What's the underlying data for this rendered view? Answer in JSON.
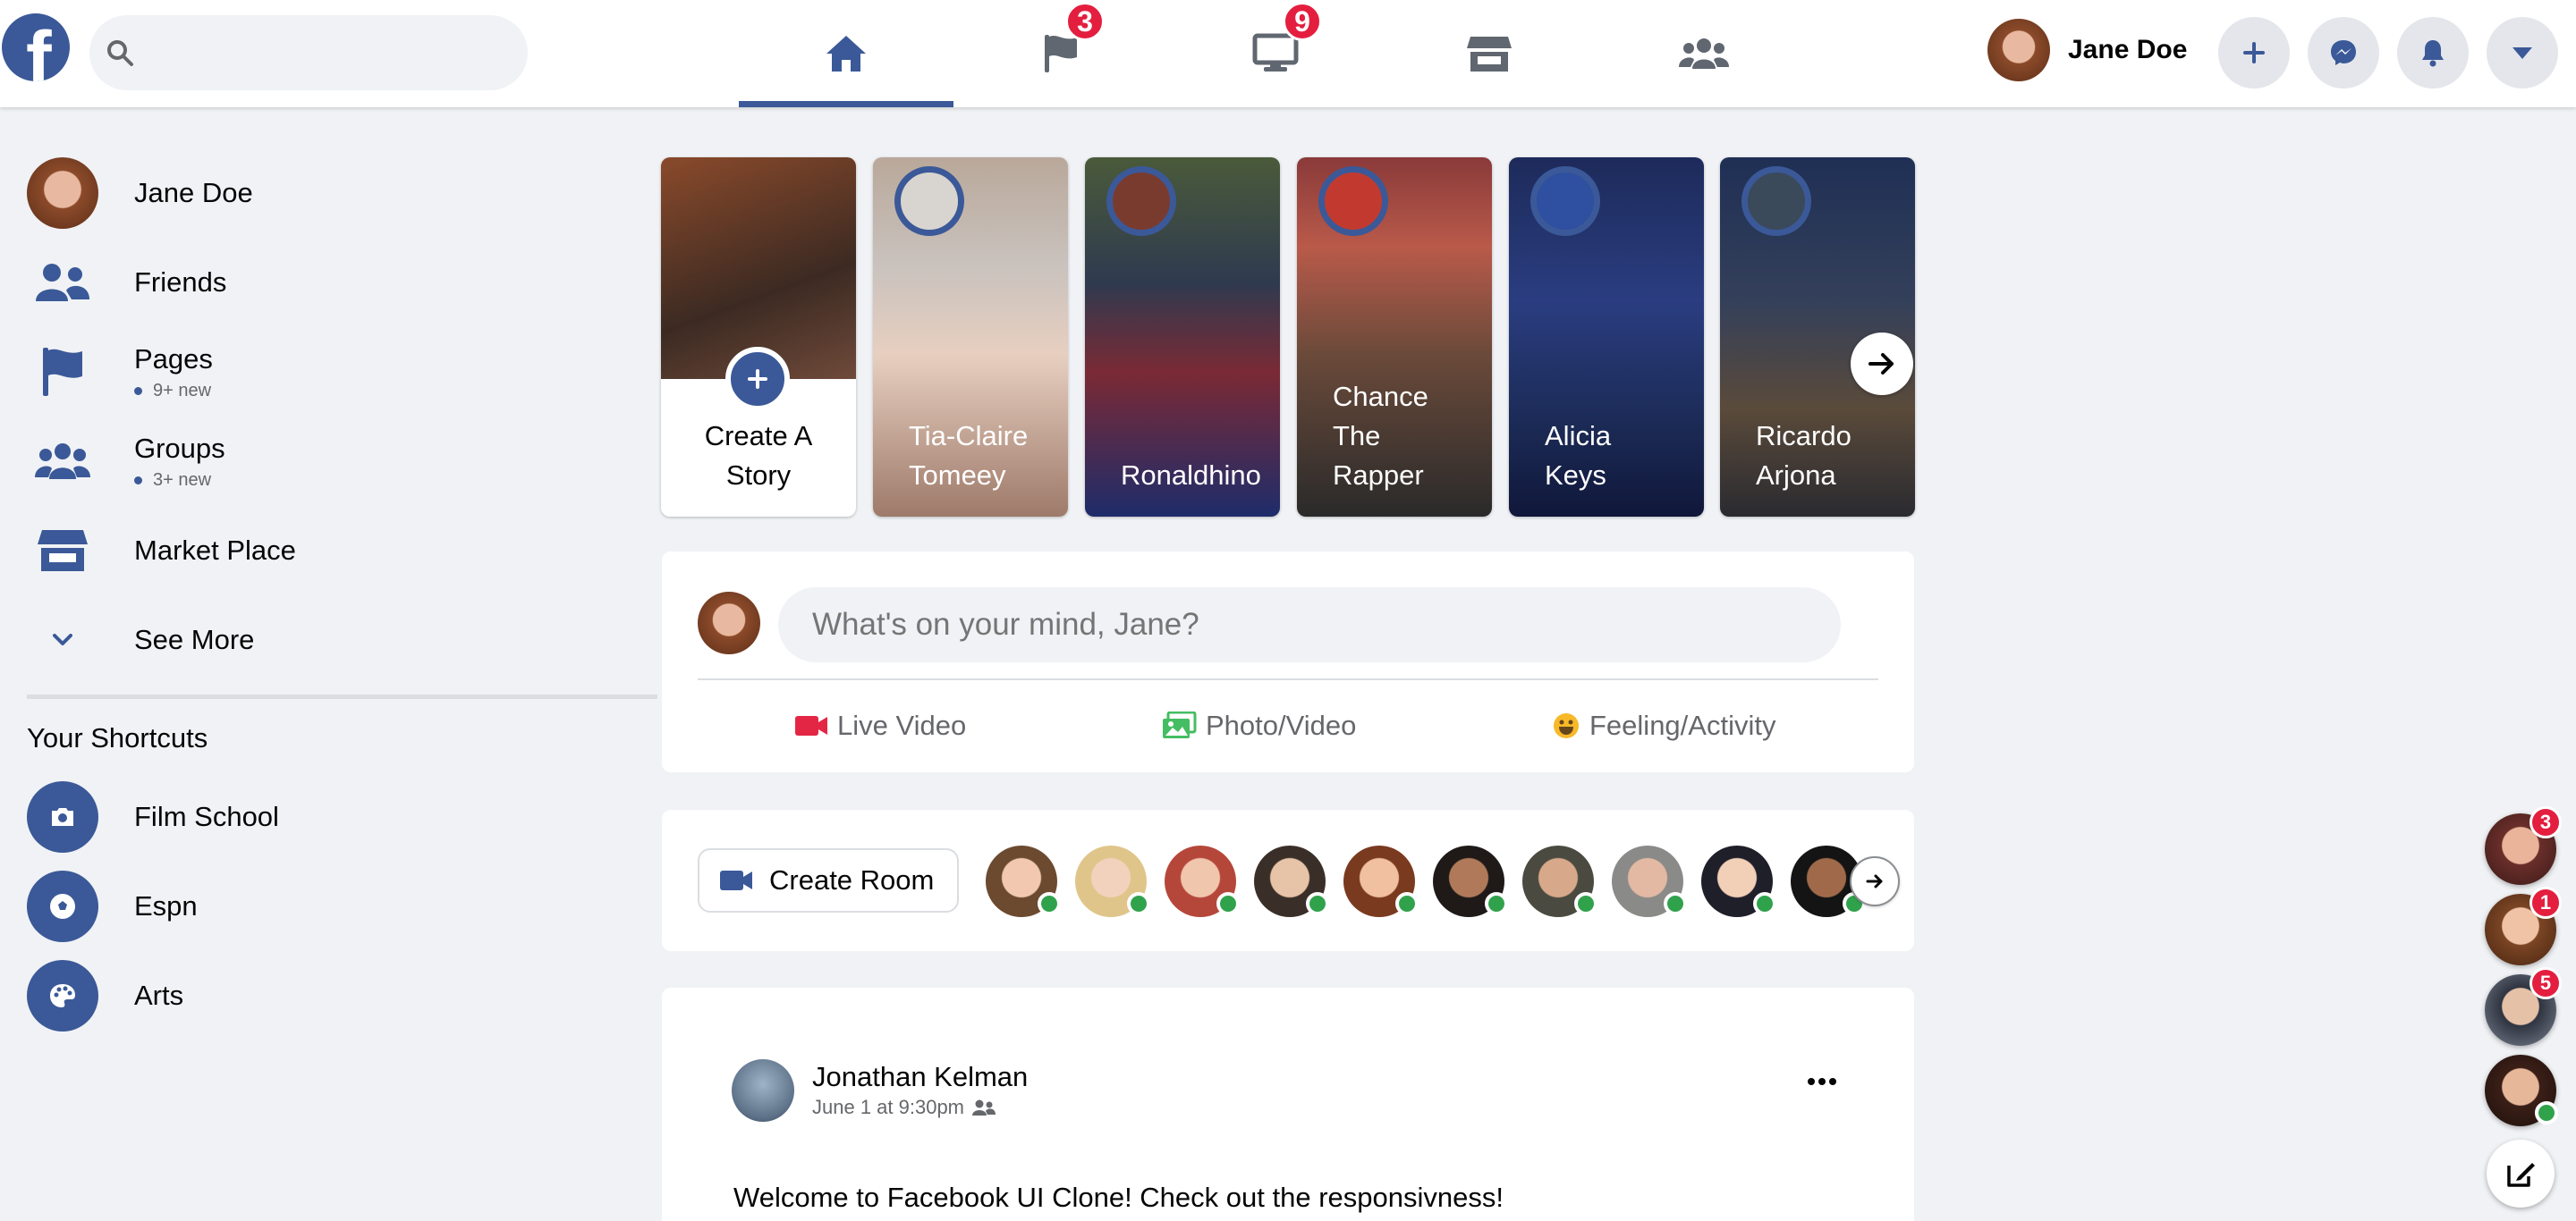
{
  "header": {
    "logo_letter": "f",
    "search_placeholder": "",
    "nav": [
      {
        "name": "home",
        "badge": null,
        "active": true
      },
      {
        "name": "pages",
        "badge": "3"
      },
      {
        "name": "watch",
        "badge": "9"
      },
      {
        "name": "marketplace",
        "badge": null
      },
      {
        "name": "groups",
        "badge": null
      }
    ],
    "user_name": "Jane Doe",
    "buttons": [
      "plus-icon",
      "messenger-icon",
      "bell-icon",
      "caret-down-icon"
    ]
  },
  "sidebar": {
    "items": [
      {
        "label": "Jane Doe",
        "icon": "avatar"
      },
      {
        "label": "Friends",
        "icon": "friends-icon"
      },
      {
        "label": "Pages",
        "sub": "9+ new",
        "icon": "flag-icon"
      },
      {
        "label": "Groups",
        "sub": "3+ new",
        "icon": "groups-icon"
      },
      {
        "label": "Market Place",
        "icon": "store-icon"
      },
      {
        "label": "See More",
        "icon": "chevron-down-icon"
      }
    ],
    "shortcuts_title": "Your Shortcuts",
    "shortcuts": [
      {
        "label": "Film School",
        "icon": "camera-icon"
      },
      {
        "label": "Espn",
        "icon": "soccer-ball-icon"
      },
      {
        "label": "Arts",
        "icon": "palette-icon"
      }
    ]
  },
  "stories": {
    "create_label": "Create A Story",
    "items": [
      {
        "label": "Tia-Claire Tomeey"
      },
      {
        "label": "Ronaldhino"
      },
      {
        "label": "Chance The Rapper"
      },
      {
        "label": "Alicia Keys"
      },
      {
        "label": "Ricardo Arjona"
      }
    ]
  },
  "composer": {
    "placeholder": "What's on your mind, Jane?",
    "actions": [
      {
        "label": "Live Video",
        "color": "#e42645"
      },
      {
        "label": "Photo/Video",
        "color": "#45bd62"
      },
      {
        "label": "Feeling/Activity",
        "color": "#f7b928"
      }
    ]
  },
  "rooms": {
    "create_label": "Create Room",
    "online_color": "#31a24c"
  },
  "post": {
    "author": "Jonathan Kelman",
    "time": "June 1 at 9:30pm",
    "text": "Welcome to Facebook UI Clone! Check out the responsivness!"
  },
  "chat_heads": [
    {
      "badge": "3"
    },
    {
      "badge": "1"
    },
    {
      "badge": "5"
    },
    {
      "badge": null,
      "online": true
    }
  ],
  "colors": {
    "brand": "#3b5998",
    "badge": "#e41e3f",
    "background": "#f0f2f5"
  }
}
